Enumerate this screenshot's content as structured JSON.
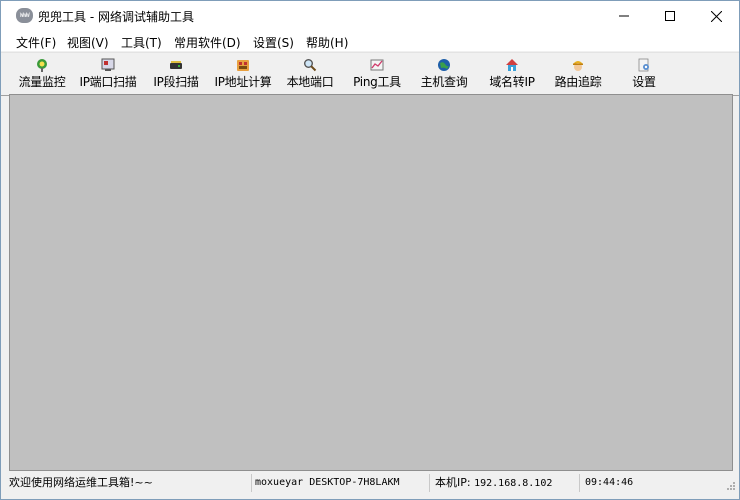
{
  "window": {
    "title": "兜兜工具 - 网络调试辅助工具",
    "app_icon_text": "WWW"
  },
  "menu": [
    {
      "label": "文件(F)"
    },
    {
      "label": "视图(V)"
    },
    {
      "label": "工具(T)"
    },
    {
      "label": "常用软件(D)"
    },
    {
      "label": "设置(S)"
    },
    {
      "label": "帮助(H)"
    }
  ],
  "toolbar": [
    {
      "label": "流量监控",
      "icon": "traffic-monitor-icon"
    },
    {
      "label": "IP端口扫描",
      "icon": "ip-port-scan-icon"
    },
    {
      "label": "IP段扫描",
      "icon": "ip-range-scan-icon"
    },
    {
      "label": "IP地址计算",
      "icon": "ip-calc-icon"
    },
    {
      "label": "本地端口",
      "icon": "magnifier-icon"
    },
    {
      "label": "Ping工具",
      "icon": "ping-icon"
    },
    {
      "label": "主机查询",
      "icon": "globe-icon"
    },
    {
      "label": "域名转IP",
      "icon": "home-icon"
    },
    {
      "label": "路由追踪",
      "icon": "worker-icon"
    },
    {
      "label": "设置",
      "icon": "settings-icon"
    }
  ],
  "status": {
    "message": "欢迎使用网络运维工具箱!~~",
    "user": "moxueyar",
    "host": "DESKTOP-7H8LAKM",
    "ip_label": "本机IP:",
    "ip": "192.168.8.102",
    "time": "09:44:46"
  }
}
